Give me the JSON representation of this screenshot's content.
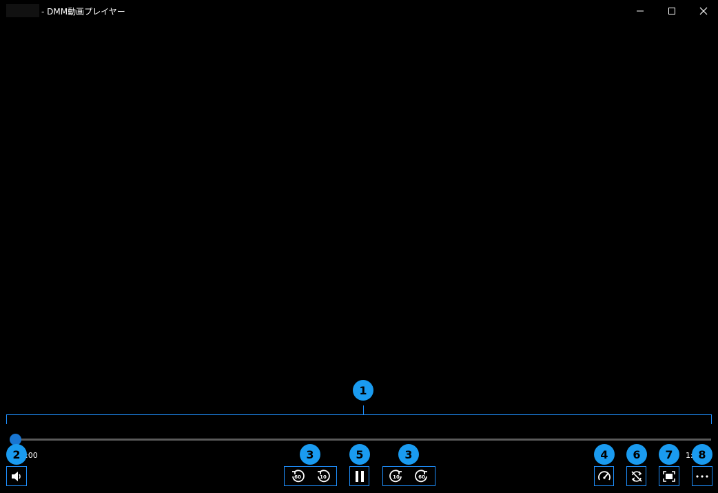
{
  "window": {
    "title": "- DMM動画プレイヤー",
    "controls": {
      "minimize": "minimize-icon",
      "maximize": "maximize-icon",
      "close": "close-icon"
    }
  },
  "player": {
    "elapsed": "0:00",
    "total": "1:",
    "progress": 0.008,
    "seek_back_labels": [
      "60",
      "10"
    ],
    "seek_forward_labels": [
      "10",
      "60"
    ]
  },
  "callouts": {
    "seekbar": "1",
    "volume": "2",
    "seek_back": "3",
    "speed": "4",
    "play_pause": "5",
    "repeat": "6",
    "fit": "7",
    "more": "8",
    "seek_forward": "3"
  },
  "colors": {
    "accent": "#1e90ff",
    "badge": "#1a9bf0",
    "thumb": "#1976d2"
  }
}
